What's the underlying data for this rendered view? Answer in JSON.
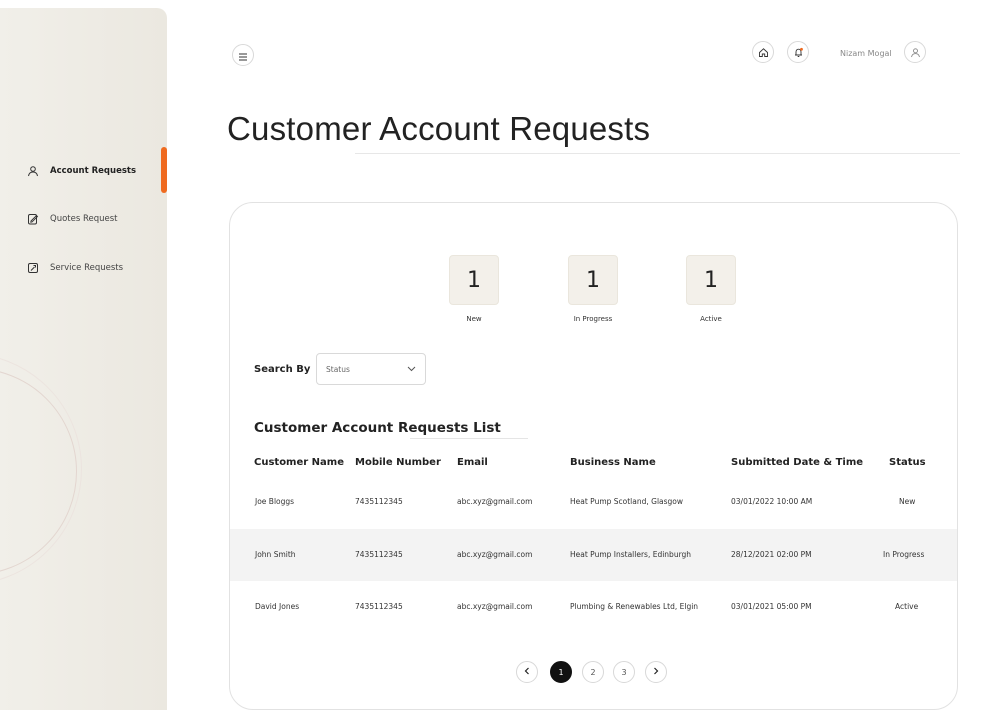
{
  "sidebar": {
    "items": [
      {
        "label": "Account Requests",
        "icon": "user-icon",
        "active": true
      },
      {
        "label": "Quotes Request",
        "icon": "document-edit-icon",
        "active": false
      },
      {
        "label": "Service Requests",
        "icon": "service-icon",
        "active": false
      }
    ]
  },
  "topbar": {
    "menu_icon": "hamburger-icon",
    "home_icon": "home-icon",
    "notification_icon": "bell-icon",
    "user_name": "Nizam Mogal",
    "avatar_icon": "user-icon"
  },
  "page": {
    "title": "Customer Account Requests"
  },
  "stats": [
    {
      "value": "1",
      "label": "New"
    },
    {
      "value": "1",
      "label": "In Progress"
    },
    {
      "value": "1",
      "label": "Active"
    }
  ],
  "search": {
    "label": "Search By",
    "selected": "Status"
  },
  "list": {
    "title": "Customer Account Requests List",
    "columns": [
      "Customer Name",
      "Mobile Number",
      "Email",
      "Business Name",
      "Submitted Date & Time",
      "Status"
    ],
    "rows": [
      {
        "name": "Joe Bloggs",
        "mobile": "7435112345",
        "email": "abc.xyz@gmail.com",
        "business": "Heat Pump Scotland, Glasgow",
        "submitted": "03/01/2022 10:00 AM",
        "status": "New"
      },
      {
        "name": "John Smith",
        "mobile": "7435112345",
        "email": "abc.xyz@gmail.com",
        "business": "Heat Pump Installers, Edinburgh",
        "submitted": "28/12/2021 02:00 PM",
        "status": "In Progress"
      },
      {
        "name": "David Jones",
        "mobile": "7435112345",
        "email": "abc.xyz@gmail.com",
        "business": "Plumbing & Renewables Ltd, Elgin",
        "submitted": "03/01/2021 05:00 PM",
        "status": "Active"
      }
    ]
  },
  "pagination": {
    "pages": [
      "1",
      "2",
      "3"
    ],
    "current": "1"
  },
  "colors": {
    "accent": "#ef6a1f",
    "sidebar_bg": "#efece6",
    "stat_bg": "#f3f0ea",
    "active_page": "#111111"
  }
}
